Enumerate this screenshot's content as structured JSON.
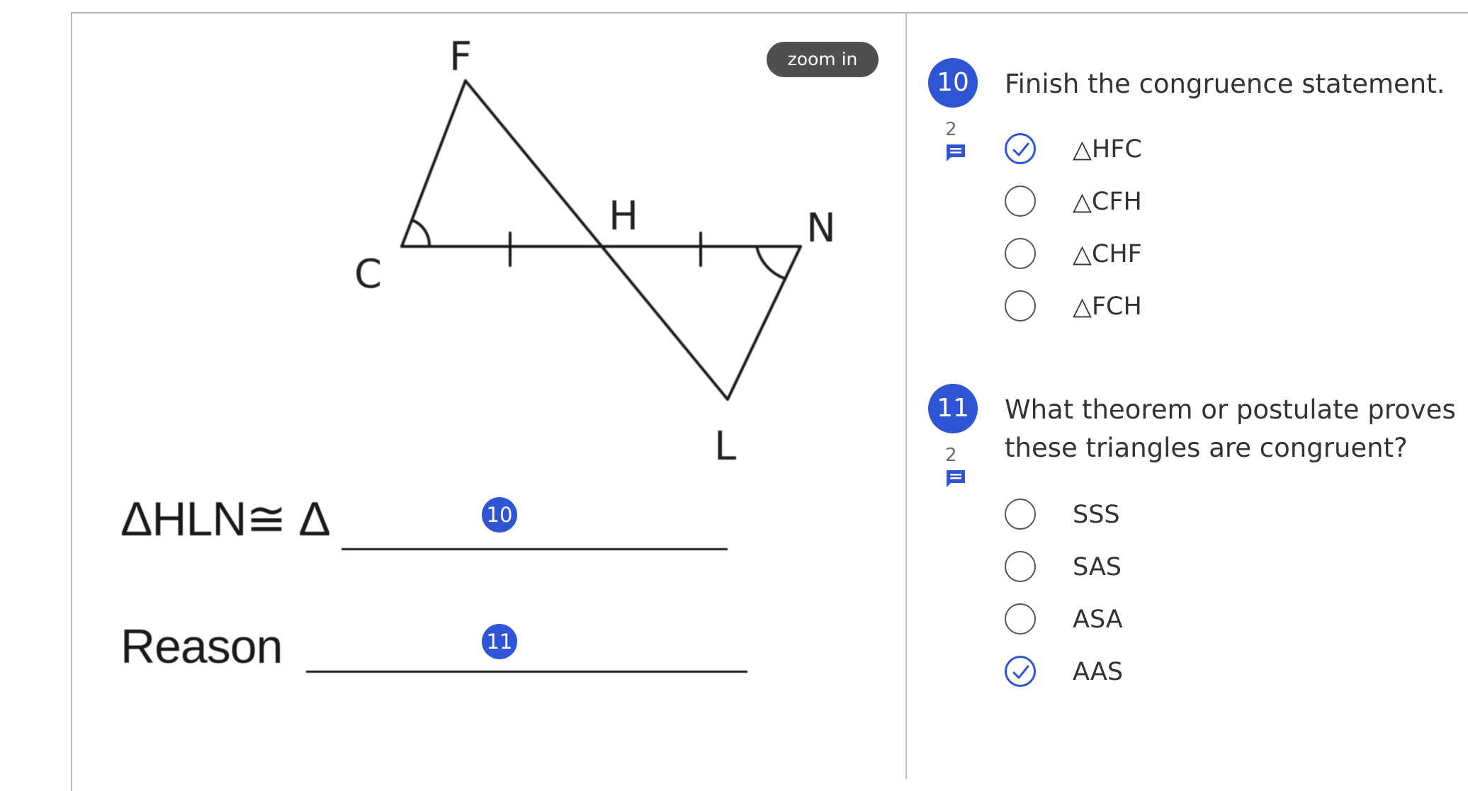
{
  "figure": {
    "zoom_label": "zoom in",
    "points": {
      "F": "F",
      "C": "C",
      "H": "H",
      "N": "N",
      "L": "L"
    },
    "statement_line": "ΔHLN≅ Δ",
    "reason_line": "Reason",
    "markers": {
      "q10": "10",
      "q11": "11"
    }
  },
  "questions": [
    {
      "number": "10",
      "attempts": "2",
      "text": "Finish the congruence statement.",
      "choices": [
        {
          "label": "△HFC",
          "checked": true
        },
        {
          "label": "△CFH",
          "checked": false
        },
        {
          "label": "△CHF",
          "checked": false
        },
        {
          "label": "△FCH",
          "checked": false
        }
      ]
    },
    {
      "number": "11",
      "attempts": "2",
      "text": "What theorem or postulate proves these triangles are congruent?",
      "choices": [
        {
          "label": "SSS",
          "checked": false
        },
        {
          "label": "SAS",
          "checked": false
        },
        {
          "label": "ASA",
          "checked": false
        },
        {
          "label": "AAS",
          "checked": true
        }
      ]
    }
  ],
  "colors": {
    "accent": "#2f55d4",
    "zoom_button": "#4f4f4f",
    "divider": "#c4c4c4"
  }
}
